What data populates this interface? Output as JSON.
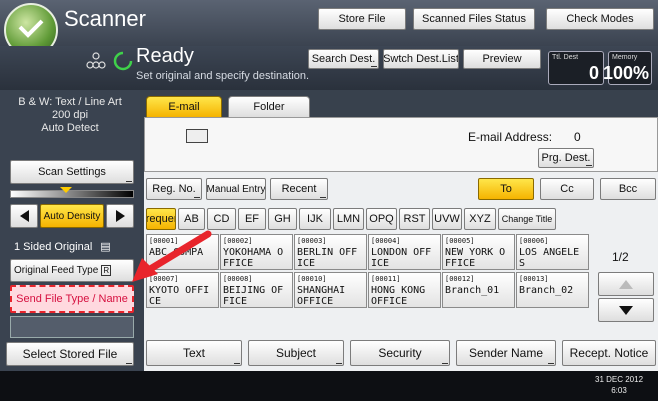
{
  "app": {
    "title": "Scanner"
  },
  "header": {
    "store_file": "Store File",
    "scanned_status": "Scanned Files Status",
    "check_modes": "Check Modes",
    "ready": "Ready",
    "instruction": "Set original and specify destination.",
    "search_dest": "Search Dest.",
    "switch_dest": "Swtch Dest.List",
    "preview": "Preview",
    "ttl_dest_label": "Ttl. Dest",
    "ttl_dest_value": "0",
    "memory_label": "Memory",
    "memory_value": "100%"
  },
  "left": {
    "scan_mode": "B & W: Text / Line Art",
    "dpi": "200 dpi",
    "detect": "Auto Detect",
    "scan_settings": "Scan Settings",
    "auto_density": "Auto Density",
    "sided": "1 Sided Original",
    "feed_type": "Original Feed Type",
    "send_file": "Send File Type / Name",
    "select_stored": "Select Stored File"
  },
  "tabs": {
    "email": "E-mail",
    "folder": "Folder"
  },
  "email": {
    "address_label": "E-mail Address:",
    "address_count": "0",
    "prg_dest": "Prg. Dest."
  },
  "dest_buttons": {
    "reg_no": "Reg. No.",
    "manual": "Manual Entry",
    "recent": "Recent",
    "to": "To",
    "cc": "Cc",
    "bcc": "Bcc"
  },
  "index_tabs": [
    "Frequent",
    "AB",
    "CD",
    "EF",
    "GH",
    "IJK",
    "LMN",
    "OPQ",
    "RST",
    "UVW",
    "XYZ",
    "Change Title"
  ],
  "entries": [
    {
      "no": "[00001]",
      "name": "ABC COMPA"
    },
    {
      "no": "[00002]",
      "name": "YOKOHAMA O FFICE"
    },
    {
      "no": "[00003]",
      "name": "BERLIN OFF ICE"
    },
    {
      "no": "[00004]",
      "name": "LONDON OFF ICE"
    },
    {
      "no": "[00005]",
      "name": "NEW YORK O FFICE"
    },
    {
      "no": "[00006]",
      "name": "LOS ANGELE S"
    },
    {
      "no": "[00007]",
      "name": "KYOTO OFFI CE"
    },
    {
      "no": "[00008]",
      "name": "BEIJING OF FICE"
    },
    {
      "no": "[00010]",
      "name": "SHANGHAI OFFICE"
    },
    {
      "no": "[00011]",
      "name": "HONG KONG OFFICE"
    },
    {
      "no": "[00012]",
      "name": "Branch_01"
    },
    {
      "no": "[00013]",
      "name": "Branch_02"
    }
  ],
  "paging": {
    "page": "1/2"
  },
  "bottom": {
    "text": "Text",
    "subject": "Subject",
    "security": "Security",
    "sender": "Sender Name",
    "recept": "Recept. Notice"
  },
  "datetime": {
    "date": "31 DEC  2012",
    "time": "6:03"
  },
  "colors": {
    "accent_yellow": "#f5b300",
    "highlight_red": "#e8242b"
  }
}
